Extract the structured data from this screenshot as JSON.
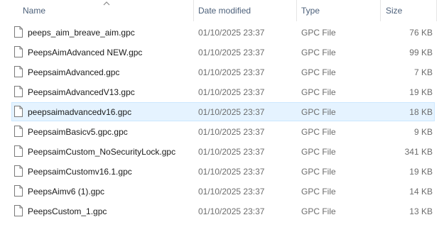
{
  "columns": {
    "name": "Name",
    "date_modified": "Date modified",
    "type": "Type",
    "size": "Size"
  },
  "sort": {
    "column": "name",
    "direction": "ascending"
  },
  "files": [
    {
      "name": "peeps_aim_breave_aim.gpc",
      "date": "01/10/2025 23:37",
      "type": "GPC File",
      "size": "76 KB",
      "selected": false
    },
    {
      "name": "PeepsAimAdvanced NEW.gpc",
      "date": "01/10/2025 23:37",
      "type": "GPC File",
      "size": "99 KB",
      "selected": false
    },
    {
      "name": "PeepsaimAdvanced.gpc",
      "date": "01/10/2025 23:37",
      "type": "GPC File",
      "size": "7 KB",
      "selected": false
    },
    {
      "name": "PeepsaimAdvancedV13.gpc",
      "date": "01/10/2025 23:37",
      "type": "GPC File",
      "size": "19 KB",
      "selected": false
    },
    {
      "name": "peepsaimadvancedv16.gpc",
      "date": "01/10/2025 23:37",
      "type": "GPC File",
      "size": "18 KB",
      "selected": true
    },
    {
      "name": "PeepsaimBasicv5.gpc.gpc",
      "date": "01/10/2025 23:37",
      "type": "GPC File",
      "size": "9 KB",
      "selected": false
    },
    {
      "name": "PeepsaimCustom_NoSecurityLock.gpc",
      "date": "01/10/2025 23:37",
      "type": "GPC File",
      "size": "341 KB",
      "selected": false
    },
    {
      "name": "PeepsaimCustomv16.1.gpc",
      "date": "01/10/2025 23:37",
      "type": "GPC File",
      "size": "19 KB",
      "selected": false
    },
    {
      "name": "PeepsAimv6 (1).gpc",
      "date": "01/10/2025 23:37",
      "type": "GPC File",
      "size": "14 KB",
      "selected": false
    },
    {
      "name": "PeepsCustom_1.gpc",
      "date": "01/10/2025 23:37",
      "type": "GPC File",
      "size": "13 KB",
      "selected": false
    }
  ],
  "colors": {
    "header_text": "#4c607a",
    "selected_bg": "#e5f3ff",
    "selected_border": "#cce8ff"
  },
  "icons": {
    "file": "file-icon",
    "sort": "sort-ascending-icon"
  }
}
